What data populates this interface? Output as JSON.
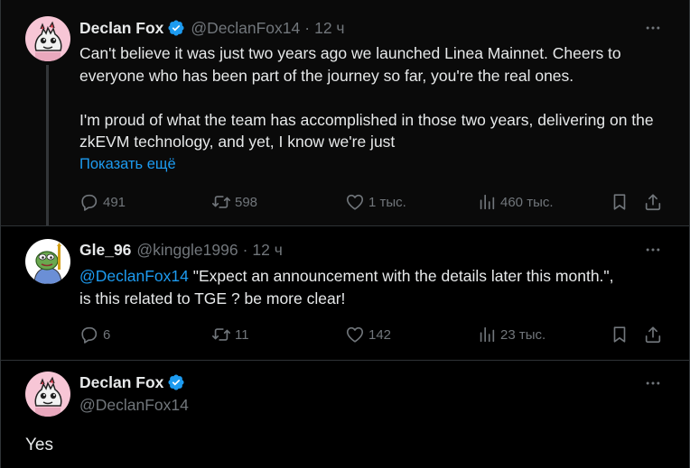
{
  "tweets": [
    {
      "author_name": "Declan Fox",
      "handle": "@DeclanFox14",
      "separator": "·",
      "time": "12 ч",
      "text_p1": "Can't believe it was just two years ago we launched Linea Mainnet. Cheers to everyone who has been part of the journey so far, you're the real ones.",
      "text_p2": "I'm proud of what the team has accomplished in those two years, delivering on the zkEVM technology, and yet, I know we're just",
      "show_more": "Показать ещё",
      "replies": "491",
      "retweets": "598",
      "likes": "1 тыс.",
      "views": "460 тыс."
    },
    {
      "author_name": "Gle_96",
      "handle": "@kinggle1996",
      "separator": "·",
      "time": "12 ч",
      "mention": "@DeclanFox14",
      "text_line1": " \"Expect an announcement with the details later this month.\",",
      "text_line2": "is this related to TGE ? be more clear!",
      "replies": "6",
      "retweets": "11",
      "likes": "142",
      "views": "23 тыс."
    },
    {
      "author_name": "Declan Fox",
      "handle": "@DeclanFox14",
      "text": "Yes"
    }
  ],
  "colors": {
    "accent": "#1d9bf0",
    "muted": "#71767b",
    "text": "#e7e9ea",
    "background": "#000000"
  },
  "icons": [
    "verified-badge-icon",
    "more-icon",
    "reply-icon",
    "retweet-icon",
    "like-icon",
    "views-icon",
    "bookmark-icon",
    "share-icon"
  ]
}
